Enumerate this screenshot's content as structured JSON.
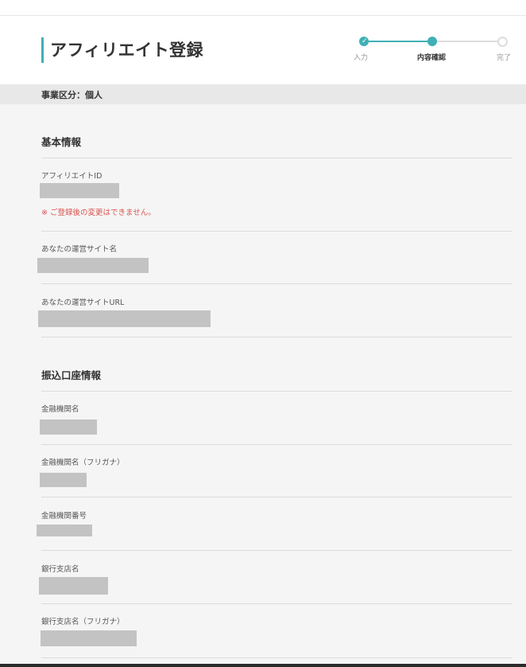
{
  "page": {
    "title": "アフィリエイト登録",
    "business_type": "事業区分：個人"
  },
  "stepper": {
    "steps": [
      {
        "label": "入力",
        "state": "done"
      },
      {
        "label": "内容確認",
        "state": "current"
      },
      {
        "label": "完了",
        "state": "pending"
      }
    ],
    "colors": {
      "active": "#3fb0b5",
      "inactive": "#dddddd"
    }
  },
  "basic_info": {
    "heading": "基本情報",
    "fields": [
      {
        "label": "アフィリエイトID",
        "value": "[redacted]"
      },
      {
        "label": "あなたの運営サイト名",
        "value": "[redacted]"
      },
      {
        "label": "あなたの運営サイトURL",
        "value": "[redacted]"
      }
    ],
    "affiliate_id_note": "※ ご登録後の変更はできません。"
  },
  "bank_info": {
    "heading": "振込口座情報",
    "fields": [
      {
        "label": "金融機関名",
        "value": "[redacted]"
      },
      {
        "label": "金融機関名（フリガナ）",
        "value": "[redacted]"
      },
      {
        "label": "金融機関番号",
        "value": "[redacted]"
      },
      {
        "label": "銀行支店名",
        "value": "[redacted]"
      },
      {
        "label": "銀行支店名（フリガナ）",
        "value": "[redacted]"
      }
    ]
  }
}
